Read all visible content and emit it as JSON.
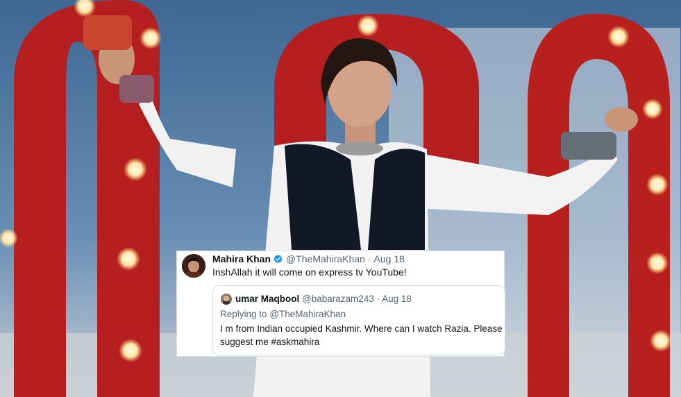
{
  "tweet": {
    "author_name": "Mahira Khan",
    "author_handle": "@TheMahiraKhan",
    "separator": "·",
    "date": "Aug 18",
    "text": "InshAllah it will come on express tv YouTube!",
    "verified_icon": "verified-badge-icon",
    "verified_color": "#1d9bf0"
  },
  "quoted_tweet": {
    "author_name": "umar Maqbool",
    "author_handle": "@babarazam243",
    "separator": "·",
    "date": "Aug 18",
    "replying_to": "Replying to @TheMahiraKhan",
    "text": "I m from Indian occupied Kashmir. Where can I watch Razia. Please suggest me #askmahira"
  }
}
